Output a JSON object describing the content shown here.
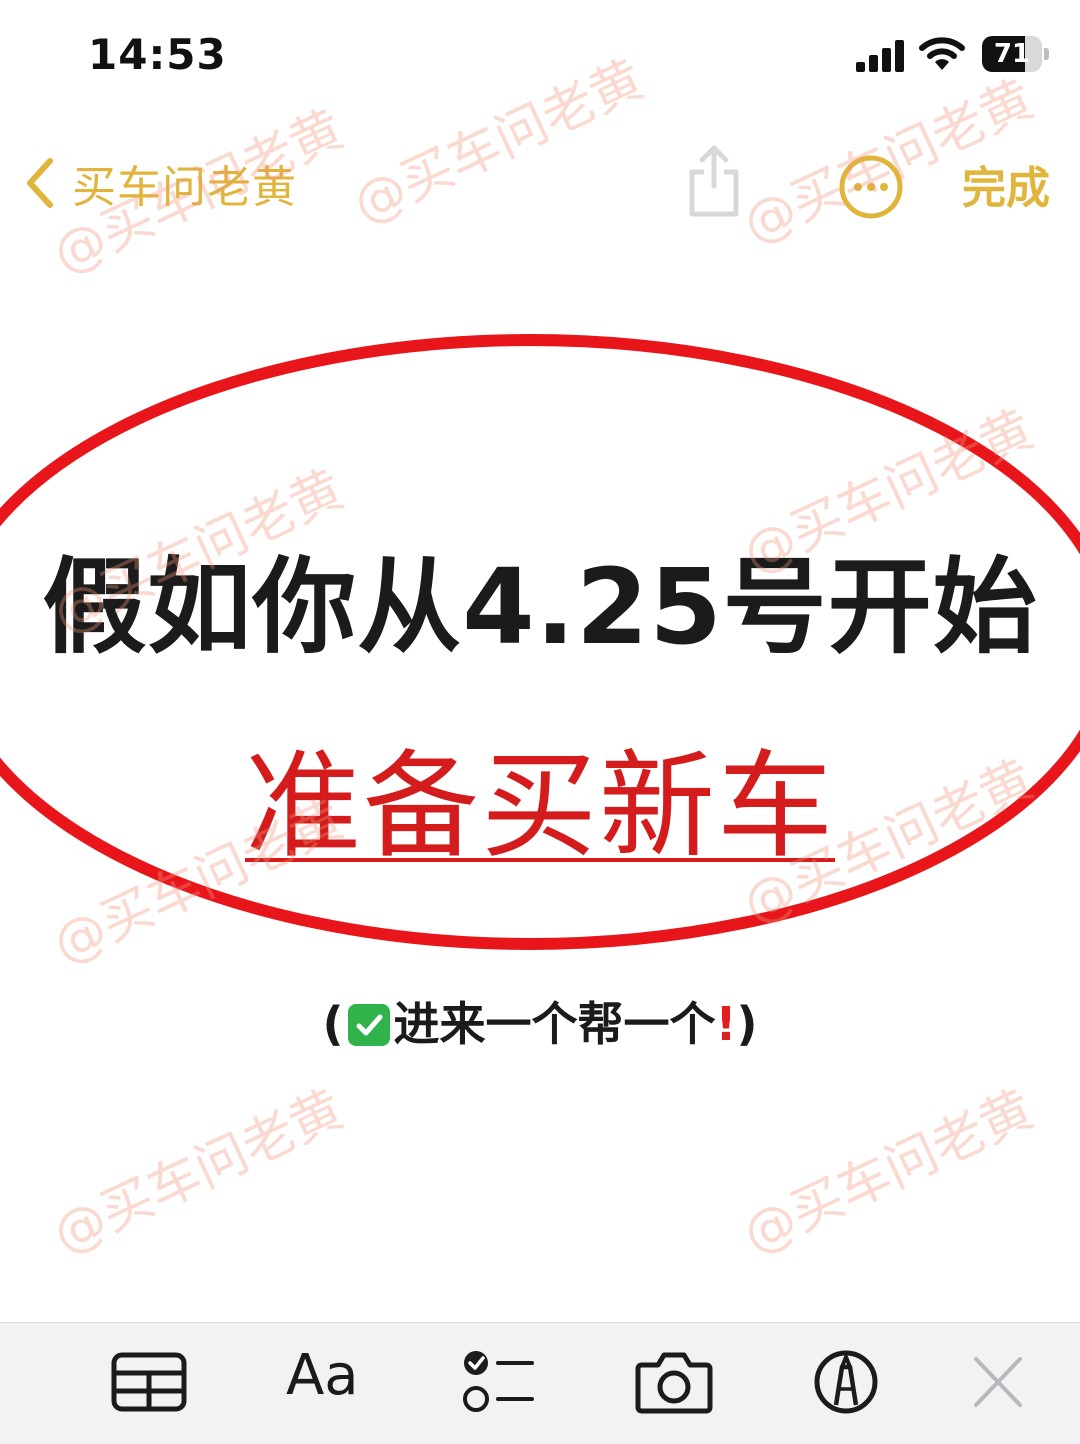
{
  "status_bar": {
    "time": "14:53",
    "battery_level": "71",
    "battery_fraction": 0.71
  },
  "nav": {
    "back_label": "买车问老黄",
    "done_label": "完成",
    "accent_color": "#e1b43b"
  },
  "note": {
    "headline": "假如你从4.25号开始",
    "subheadline": "准备买新车",
    "caption_open": "(",
    "caption_text": "进来一个帮一个",
    "caption_exclaim": "!",
    "caption_close": ")",
    "ellipse_color": "#e8161b",
    "subheadline_color": "#d41c1c"
  },
  "watermark": {
    "text": "@买车问老黄"
  },
  "toolbar": {
    "format_label": "Aa"
  },
  "icons": {
    "back": "chevron-left-icon",
    "share": "share-icon",
    "more": "ellipsis-circle-icon",
    "table": "table-icon",
    "checklist": "checklist-icon",
    "camera": "camera-icon",
    "markup": "pen-circle-icon",
    "close": "close-icon"
  }
}
